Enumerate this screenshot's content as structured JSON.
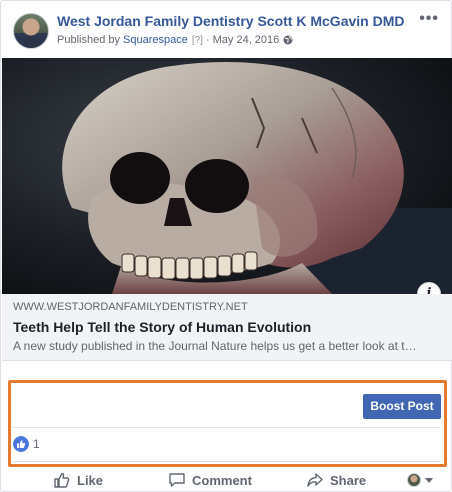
{
  "post": {
    "page_name": "West Jordan Family Dentistry Scott K McGavin DMD",
    "published_by_prefix": "Published by",
    "published_by_link": "Squarespace",
    "help_marker": "[?]",
    "separator": "·",
    "date": "May 24, 2016",
    "more_icon": "ellipsis-icon",
    "privacy_icon": "globe-icon"
  },
  "link_preview": {
    "domain": "WWW.WESTJORDANFAMILYDENTISTRY.NET",
    "title": "Teeth Help Tell the Story of Human Evolution",
    "description": "A new study published in the Journal Nature helps us get a better look at t…",
    "info_glyph": "i"
  },
  "boost": {
    "label": "Boost Post",
    "color": "#4267b2"
  },
  "reactions": {
    "count": "1",
    "icon": "like-reaction-icon",
    "color": "#4a77de"
  },
  "actions": {
    "like": "Like",
    "comment": "Comment",
    "share": "Share"
  },
  "highlight_color": "#e47a30"
}
